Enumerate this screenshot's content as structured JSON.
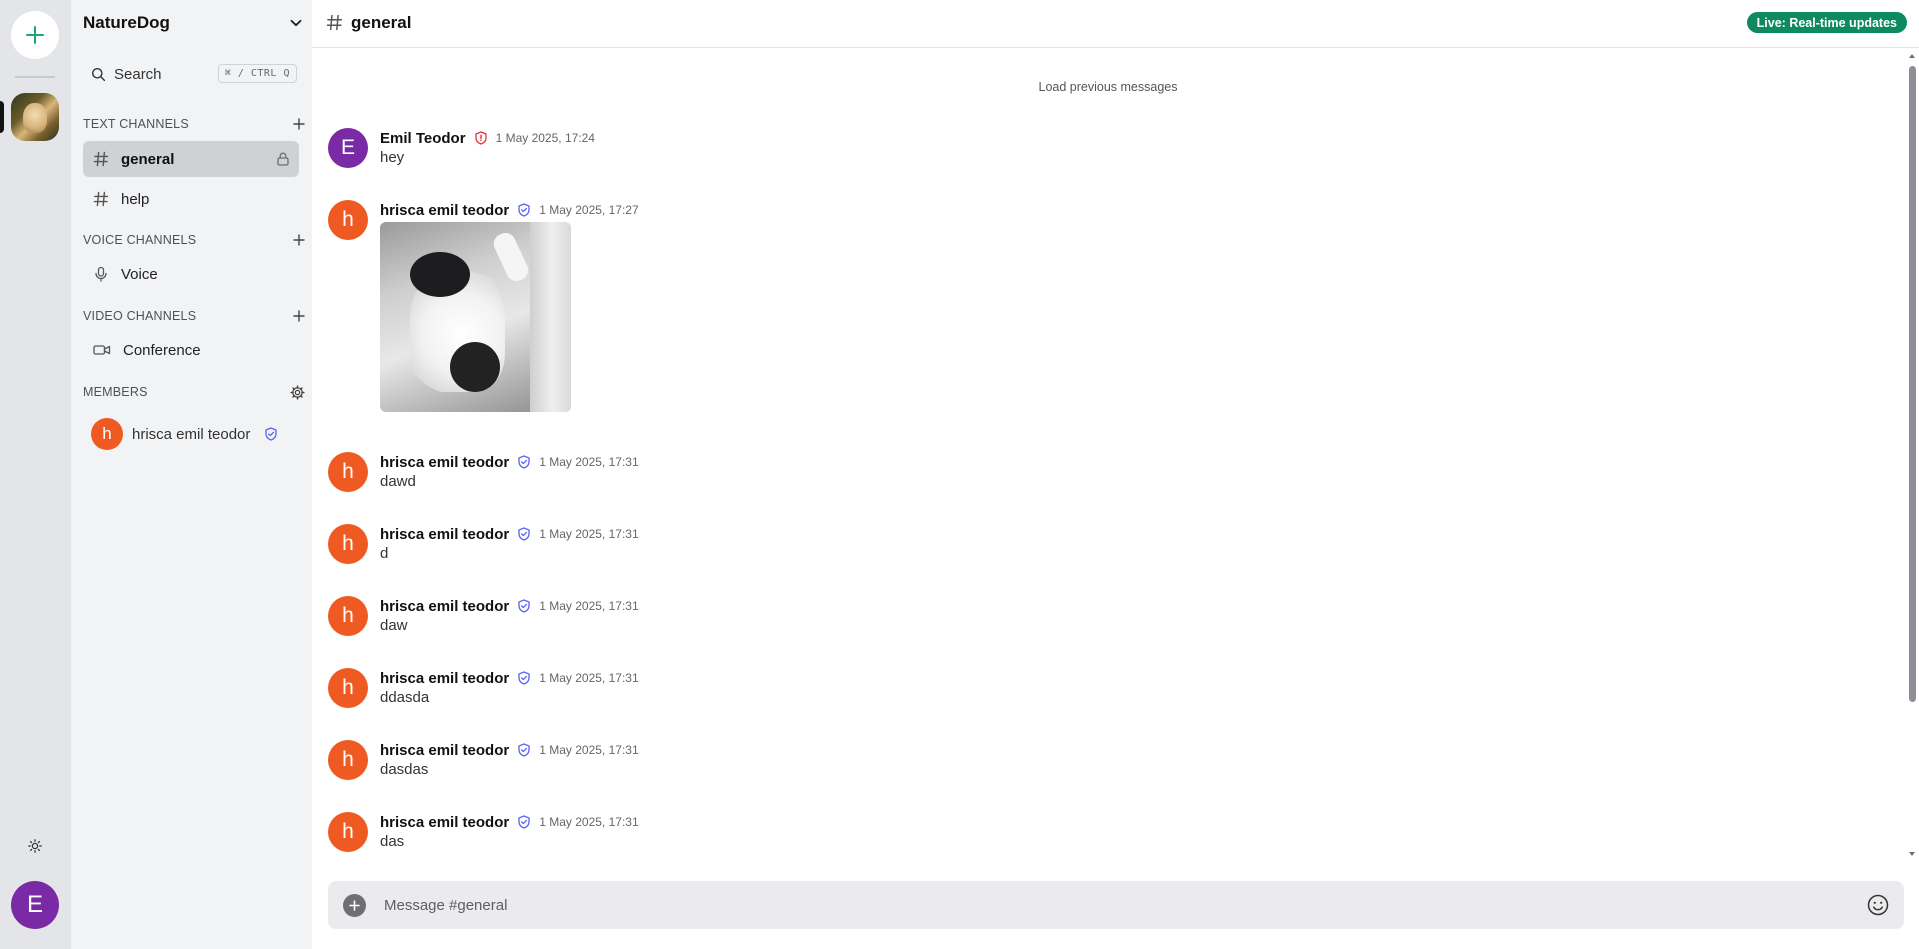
{
  "server": {
    "name": "NatureDog"
  },
  "search": {
    "label": "Search",
    "shortcut": "⌘ / CTRL Q"
  },
  "sections": {
    "text": "TEXT CHANNELS",
    "voice": "VOICE CHANNELS",
    "video": "VIDEO CHANNELS",
    "members": "MEMBERS"
  },
  "channels": {
    "text": [
      {
        "label": "general",
        "active": true,
        "locked": true
      },
      {
        "label": "help",
        "active": false,
        "locked": false
      }
    ],
    "voice": [
      {
        "label": "Voice"
      }
    ],
    "video": [
      {
        "label": "Conference"
      }
    ]
  },
  "members": [
    {
      "initial": "h",
      "name": "hrisca emil teodor",
      "color": "#ef5a22"
    }
  ],
  "rail": {
    "user_initial": "E"
  },
  "topbar": {
    "title": "general",
    "live_badge": "Live: Real-time updates"
  },
  "chat": {
    "load_previous": "Load previous messages",
    "messages": [
      {
        "initial": "E",
        "author": "Emil Teodor",
        "badge": "admin-shield",
        "time": "1 May 2025, 17:24",
        "text": "hey",
        "avatar_color": "#7b2aa6"
      },
      {
        "initial": "h",
        "author": "hrisca emil teodor",
        "badge": "verified-shield",
        "time": "1 May 2025, 17:27",
        "text": "",
        "image": "cat-photo",
        "avatar_color": "#ef5a22"
      },
      {
        "initial": "h",
        "author": "hrisca emil teodor",
        "badge": "verified-shield",
        "time": "1 May 2025, 17:31",
        "text": "dawd",
        "avatar_color": "#ef5a22"
      },
      {
        "initial": "h",
        "author": "hrisca emil teodor",
        "badge": "verified-shield",
        "time": "1 May 2025, 17:31",
        "text": "d",
        "avatar_color": "#ef5a22"
      },
      {
        "initial": "h",
        "author": "hrisca emil teodor",
        "badge": "verified-shield",
        "time": "1 May 2025, 17:31",
        "text": "daw",
        "avatar_color": "#ef5a22"
      },
      {
        "initial": "h",
        "author": "hrisca emil teodor",
        "badge": "verified-shield",
        "time": "1 May 2025, 17:31",
        "text": "ddasda",
        "avatar_color": "#ef5a22"
      },
      {
        "initial": "h",
        "author": "hrisca emil teodor",
        "badge": "verified-shield",
        "time": "1 May 2025, 17:31",
        "text": "dasdas",
        "avatar_color": "#ef5a22"
      },
      {
        "initial": "h",
        "author": "hrisca emil teodor",
        "badge": "verified-shield",
        "time": "1 May 2025, 17:31",
        "text": "das",
        "avatar_color": "#ef5a22"
      }
    ]
  },
  "composer": {
    "placeholder": "Message #general"
  },
  "colors": {
    "accent_green": "#0d8a60",
    "add_icon_green": "#1fa37a",
    "admin_badge": "#e0313a",
    "verified_badge": "#5865f2"
  }
}
